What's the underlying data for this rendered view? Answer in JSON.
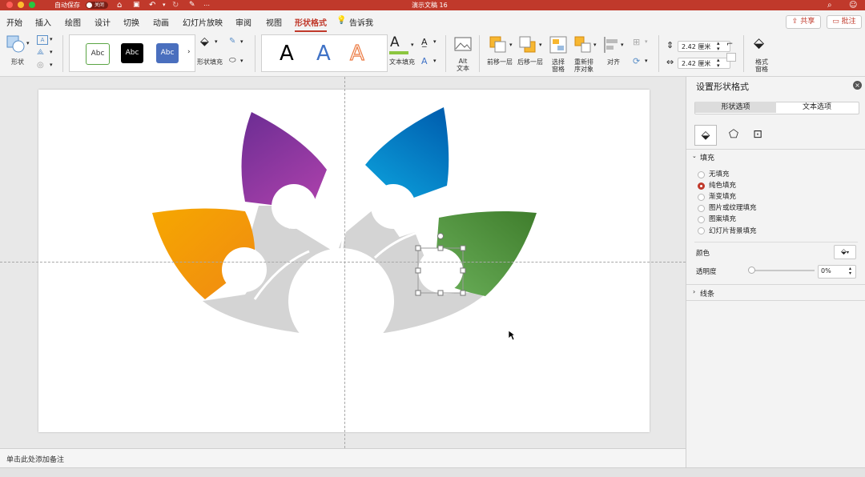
{
  "window": {
    "title": "演示文稿 16",
    "autosave_label": "自动保存",
    "autosave_state": "关闭"
  },
  "tabs": [
    "开始",
    "插入",
    "绘图",
    "设计",
    "切换",
    "动画",
    "幻灯片放映",
    "审阅",
    "视图",
    "形状格式"
  ],
  "active_tab": "形状格式",
  "tell_me": "告诉我",
  "share_label": "共享",
  "comment_label": "批注",
  "ribbon": {
    "shape_label": "形状",
    "style_samples": [
      "Abc",
      "Abc",
      "Abc"
    ],
    "shape_fill_label": "形状填充",
    "wordart_samples": [
      "A",
      "A",
      "A"
    ],
    "text_fill_label": "文本填充",
    "alt_text_label": "Alt\n文本",
    "bring_forward": "前移一层",
    "send_backward": "后移一层",
    "selection_pane": "选择\n窗格",
    "reorder": "重新排\n序对象",
    "align": "对齐",
    "height_value": "2.42 厘米",
    "width_value": "2.42 厘米",
    "format_pane": "格式\n窗格"
  },
  "notes_placeholder": "单击此处添加备注",
  "panel": {
    "title": "设置形状格式",
    "tab_shape": "形状选项",
    "tab_text": "文本选项",
    "fill_section": "填充",
    "fill_options": [
      "无填充",
      "纯色填充",
      "渐变填充",
      "图片或纹理填充",
      "图案填充",
      "幻灯片背景填充"
    ],
    "selected_fill": "纯色填充",
    "color_label": "颜色",
    "transparency_label": "透明度",
    "transparency_value": "0%",
    "line_section": "线条"
  },
  "colors": {
    "accent": "#c0392b",
    "petal_orange": "#f29a0a",
    "petal_purple": "#8a3aa5",
    "petal_blue": "#0a7cc3",
    "petal_green": "#4e8d3e",
    "gray_shape": "#d4d4d4"
  }
}
